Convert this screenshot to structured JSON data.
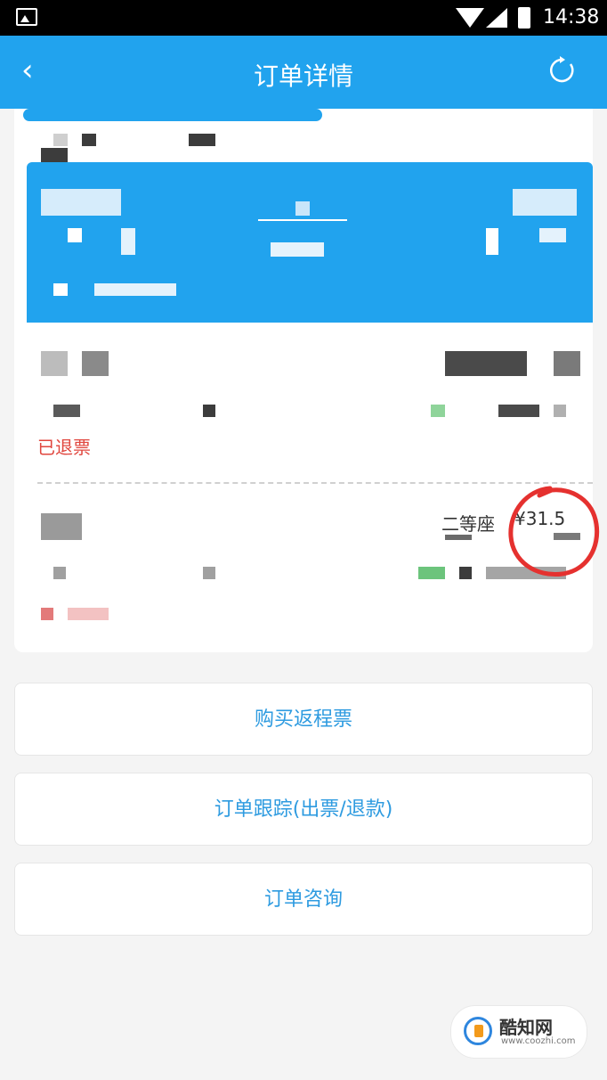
{
  "status_bar": {
    "time": "14:38"
  },
  "nav": {
    "back_icon": "‹",
    "title": "订单详情",
    "refresh_icon": "refresh-icon"
  },
  "ticket": {
    "status": "已退票",
    "seat_class": "二等座",
    "price": "¥31.5"
  },
  "actions": [
    {
      "label": "购买返程票"
    },
    {
      "label": "订单跟踪(出票/退款)"
    },
    {
      "label": "订单咨询"
    }
  ],
  "watermark": {
    "name": "酷知网",
    "url": "www.coozhi.com"
  },
  "colors": {
    "accent": "#21a3ee",
    "refund_red": "#e0463e",
    "action_blue": "#2e9be0"
  }
}
